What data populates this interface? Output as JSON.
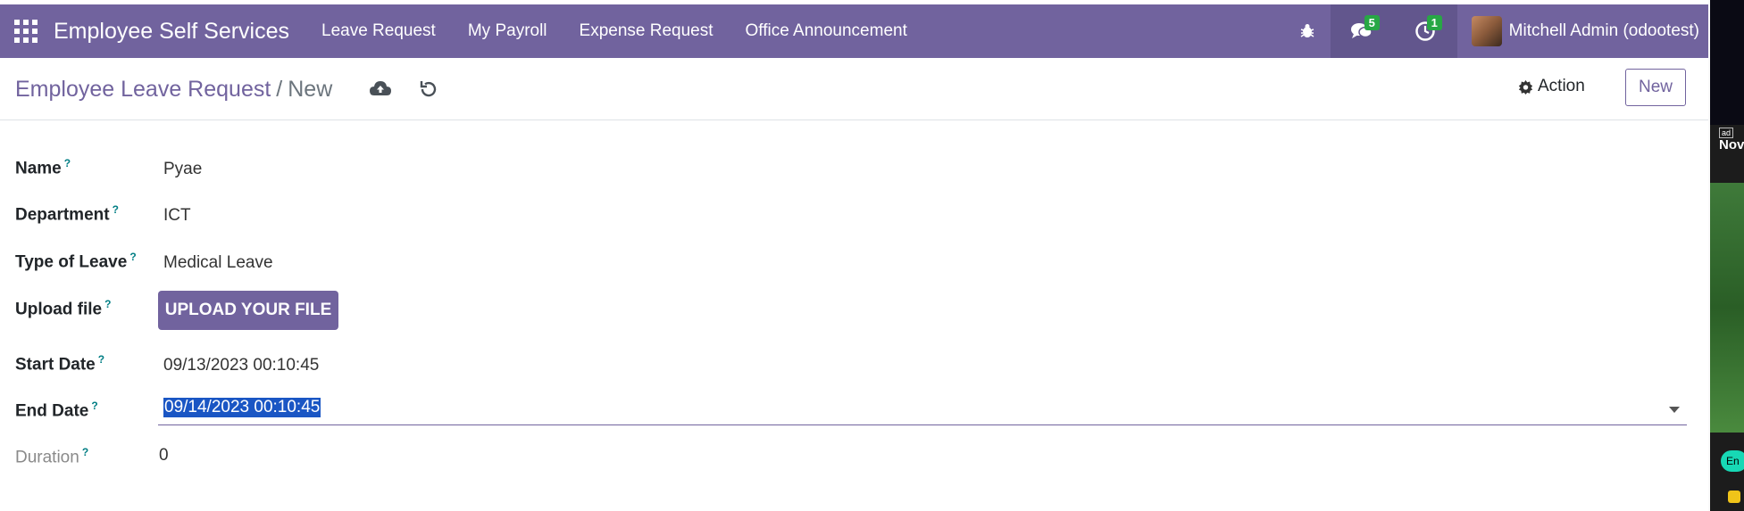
{
  "navbar": {
    "app_name": "Employee Self Services",
    "menu": [
      "Leave Request",
      "My Payroll",
      "Expense Request",
      "Office Announcement"
    ],
    "messages_count": "5",
    "activities_count": "1",
    "user_name": "Mitchell Admin (odootest)"
  },
  "control_panel": {
    "breadcrumb_parent": "Employee Leave Request",
    "breadcrumb_separator": "/",
    "breadcrumb_current": "New",
    "action_label": "Action",
    "new_label": "New"
  },
  "form": {
    "name": {
      "label": "Name",
      "help": "?",
      "value": "Pyae"
    },
    "department": {
      "label": "Department",
      "help": "?",
      "value": "ICT"
    },
    "type_of_leave": {
      "label": "Type of Leave",
      "help": "?",
      "value": "Medical Leave"
    },
    "upload_file": {
      "label": "Upload file",
      "help": "?",
      "button_label": "UPLOAD YOUR FILE"
    },
    "start_date": {
      "label": "Start Date",
      "help": "?",
      "value": "09/13/2023 00:10:45"
    },
    "end_date": {
      "label": "End Date",
      "help": "?",
      "value": "09/14/2023 00:10:45"
    },
    "duration": {
      "label": "Duration",
      "help": "?",
      "value": "0"
    }
  },
  "side_panel": {
    "ad_label": "ad",
    "headline": "Nov",
    "button_label": "En"
  },
  "colors": {
    "brand": "#71639e",
    "badge": "#28a745",
    "help": "#017e84",
    "selection": "#1a56c4"
  }
}
